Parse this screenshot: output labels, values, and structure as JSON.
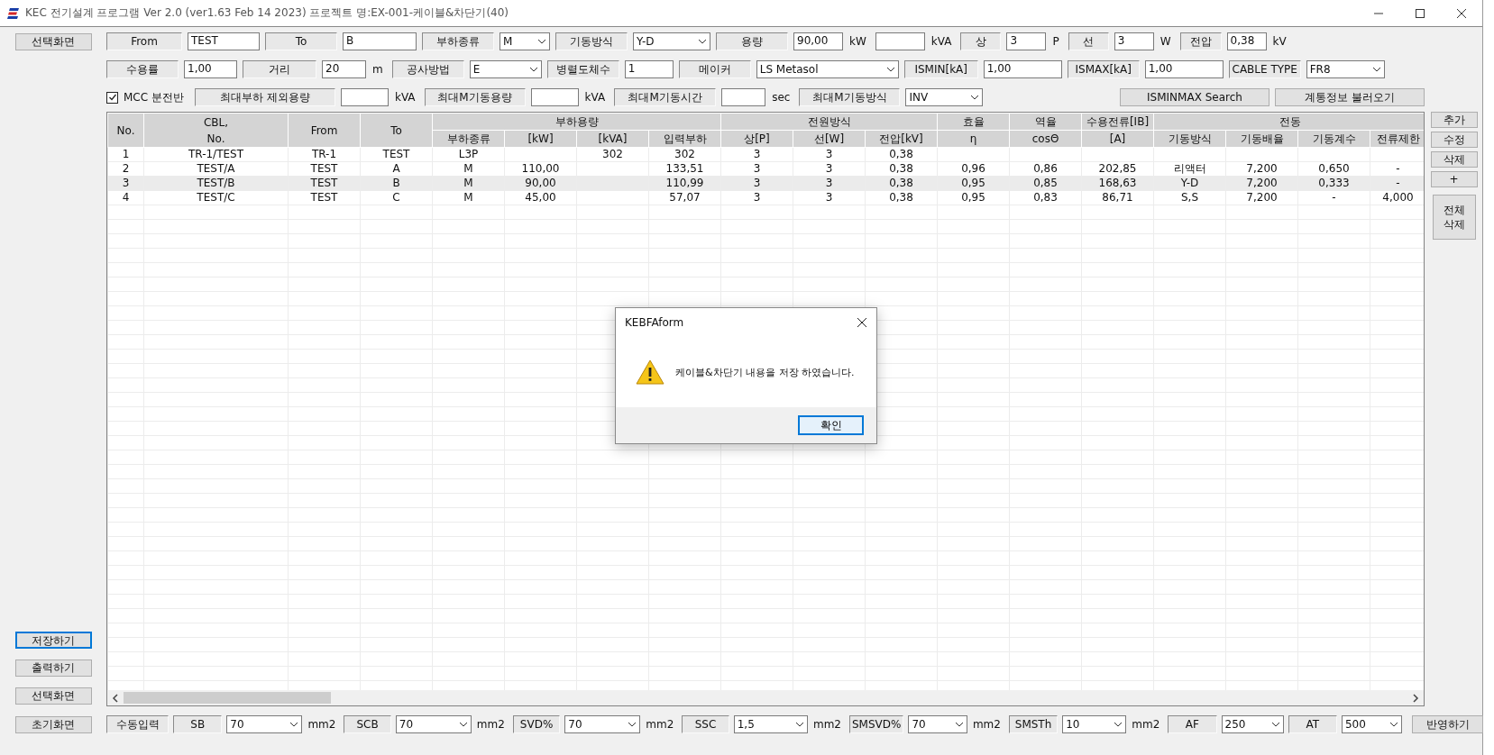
{
  "window": {
    "title": "KEC 전기설계 프로그램 Ver 2.0 (ver1.63 Feb 14 2023) 프로젝트 명:EX-001-케이블&차단기(40)"
  },
  "top_button": "선택화면",
  "form_rows": [
    [
      {
        "kind": "label",
        "text": "From"
      },
      {
        "kind": "field",
        "value": "TEST"
      },
      {
        "kind": "label",
        "text": "To"
      },
      {
        "kind": "field",
        "value": "B"
      },
      {
        "kind": "label",
        "text": "부하종류"
      },
      {
        "kind": "select",
        "value": "M"
      },
      {
        "kind": "label",
        "text": "기동방식"
      },
      {
        "kind": "select",
        "value": "Y-D"
      },
      {
        "kind": "label",
        "text": "용량"
      },
      {
        "kind": "field",
        "value": "90,00"
      },
      {
        "kind": "unit",
        "text": "kW"
      },
      {
        "kind": "field"
      },
      {
        "kind": "unit",
        "text": "kVA"
      },
      {
        "kind": "label",
        "text": "상"
      },
      {
        "kind": "field",
        "value": "3"
      },
      {
        "kind": "unit",
        "text": "P"
      },
      {
        "kind": "label",
        "text": "선"
      },
      {
        "kind": "field",
        "value": "3"
      },
      {
        "kind": "unit",
        "text": "W"
      },
      {
        "kind": "label",
        "text": "전압"
      },
      {
        "kind": "field",
        "value": "0,38"
      },
      {
        "kind": "unit",
        "text": "kV"
      }
    ],
    [
      {
        "kind": "label",
        "text": "수용률"
      },
      {
        "kind": "field",
        "value": "1,00"
      },
      {
        "kind": "label",
        "text": "거리"
      },
      {
        "kind": "field",
        "value": "20"
      },
      {
        "kind": "unit",
        "text": "m"
      },
      {
        "kind": "label",
        "text": "공사방법"
      },
      {
        "kind": "select",
        "value": "E"
      },
      {
        "kind": "label",
        "text": "병렬도체수"
      },
      {
        "kind": "field",
        "value": "1"
      },
      {
        "kind": "label",
        "text": "메이커"
      },
      {
        "kind": "select",
        "value": "LS Metasol"
      },
      {
        "kind": "label",
        "text": "ISMIN[kA]"
      },
      {
        "kind": "field",
        "value": "1,00"
      },
      {
        "kind": "label",
        "text": "ISMAX[kA]"
      },
      {
        "kind": "field",
        "value": "1,00"
      },
      {
        "kind": "label",
        "text": "CABLE TYPE"
      },
      {
        "kind": "select",
        "value": "FR8"
      }
    ],
    [
      {
        "kind": "checkbox",
        "text": "MCC 분전반",
        "checked": true
      },
      {
        "kind": "label",
        "text": "최대부하 제외용량"
      },
      {
        "kind": "field"
      },
      {
        "kind": "unit",
        "text": "kVA"
      },
      {
        "kind": "label",
        "text": "최대M기동용량"
      },
      {
        "kind": "field"
      },
      {
        "kind": "unit",
        "text": "kVA"
      },
      {
        "kind": "label",
        "text": "최대M기동시간"
      },
      {
        "kind": "field"
      },
      {
        "kind": "unit",
        "text": "sec"
      },
      {
        "kind": "label",
        "text": "최대M기동방식"
      },
      {
        "kind": "select",
        "value": "INV"
      },
      {
        "kind": "button",
        "text": "ISMINMAX Search"
      },
      {
        "kind": "button",
        "text": "계통정보 불러오기"
      }
    ]
  ],
  "left_buttons": [
    {
      "label": "저장하기",
      "focused": true
    },
    {
      "label": "출력하기",
      "focused": false
    },
    {
      "label": "선택화면",
      "focused": false
    }
  ],
  "table": {
    "header_groups": [
      {
        "label": "No."
      },
      {
        "label": "CBL,\nNo."
      },
      {
        "label": "From"
      },
      {
        "label": "To"
      },
      {
        "label": "부하용량",
        "columns": [
          "부하종류",
          "[kW]",
          "[kVA]",
          "입력부하"
        ]
      },
      {
        "label": "전원방식",
        "columns": [
          "상[P]",
          "선[W]",
          "전압[kV]"
        ]
      },
      {
        "label": "효율",
        "columns": [
          "η"
        ]
      },
      {
        "label": "역율",
        "columns": [
          "cosΘ"
        ]
      },
      {
        "label": "수용전류[IB]",
        "columns": [
          "[A]"
        ]
      },
      {
        "label": "전동",
        "columns": [
          "기동방식",
          "기동배율",
          "기동계수",
          "전류제한"
        ]
      }
    ],
    "rows": [
      {
        "selected": false,
        "cells": [
          "1",
          "TR-1/TEST",
          "TR-1",
          "TEST",
          "L3P",
          null,
          "302",
          "302",
          "3",
          "3",
          "0,38",
          null,
          null,
          null,
          null,
          null,
          null,
          null
        ]
      },
      {
        "selected": false,
        "cells": [
          "2",
          "TEST/A",
          "TEST",
          "A",
          "M",
          "110,00",
          null,
          "133,51",
          "3",
          "3",
          "0,38",
          "0,96",
          "0,86",
          "202,85",
          "리액터",
          "7,200",
          "0,650",
          "-"
        ]
      },
      {
        "selected": true,
        "cells": [
          "3",
          "TEST/B",
          "TEST",
          "B",
          "M",
          "90,00",
          null,
          "110,99",
          "3",
          "3",
          "0,38",
          "0,95",
          "0,85",
          "168,63",
          "Y-D",
          "7,200",
          "0,333",
          "-"
        ]
      },
      {
        "selected": false,
        "cells": [
          "4",
          "TEST/C",
          "TEST",
          "C",
          "M",
          "45,00",
          null,
          "57,07",
          "3",
          "3",
          "0,38",
          "0,95",
          "0,83",
          "86,71",
          "S,S",
          "7,200",
          "-",
          "4,000"
        ]
      }
    ]
  },
  "right_buttons": [
    {
      "kind": "small",
      "label": "추가"
    },
    {
      "kind": "small",
      "label": "수정"
    },
    {
      "kind": "small",
      "label": "삭제"
    },
    {
      "kind": "small",
      "label": "+"
    },
    {
      "kind": "tall",
      "label": "전체 삭제"
    }
  ],
  "bottom_button": "초기화면",
  "bottom_bar": [
    {
      "kind": "label",
      "text": "수동입력"
    },
    {
      "kind": "label",
      "text": "SB"
    },
    {
      "kind": "select",
      "value": "70"
    },
    {
      "kind": "unit",
      "text": "mm2"
    },
    {
      "kind": "label",
      "text": "SCB"
    },
    {
      "kind": "select",
      "value": "70"
    },
    {
      "kind": "unit",
      "text": "mm2"
    },
    {
      "kind": "label",
      "text": "SVD%"
    },
    {
      "kind": "select",
      "value": "70"
    },
    {
      "kind": "unit",
      "text": "mm2"
    },
    {
      "kind": "label",
      "text": "SSC"
    },
    {
      "kind": "select",
      "value": "1,5"
    },
    {
      "kind": "unit",
      "text": "mm2"
    },
    {
      "kind": "label",
      "text": "SMSVD%"
    },
    {
      "kind": "select",
      "value": "70"
    },
    {
      "kind": "unit",
      "text": "mm2"
    },
    {
      "kind": "label",
      "text": "SMSTh"
    },
    {
      "kind": "select",
      "value": "10"
    },
    {
      "kind": "unit",
      "text": "mm2"
    },
    {
      "kind": "label",
      "text": "AF"
    },
    {
      "kind": "select",
      "value": "250"
    },
    {
      "kind": "label",
      "text": "AT"
    },
    {
      "kind": "select",
      "value": "500"
    },
    {
      "kind": "button",
      "text": "반영하기"
    }
  ],
  "dialog": {
    "title": "KEBFAform",
    "message": "케이블&차단기 내용을 저장 하였습니다.",
    "button": "확인"
  }
}
